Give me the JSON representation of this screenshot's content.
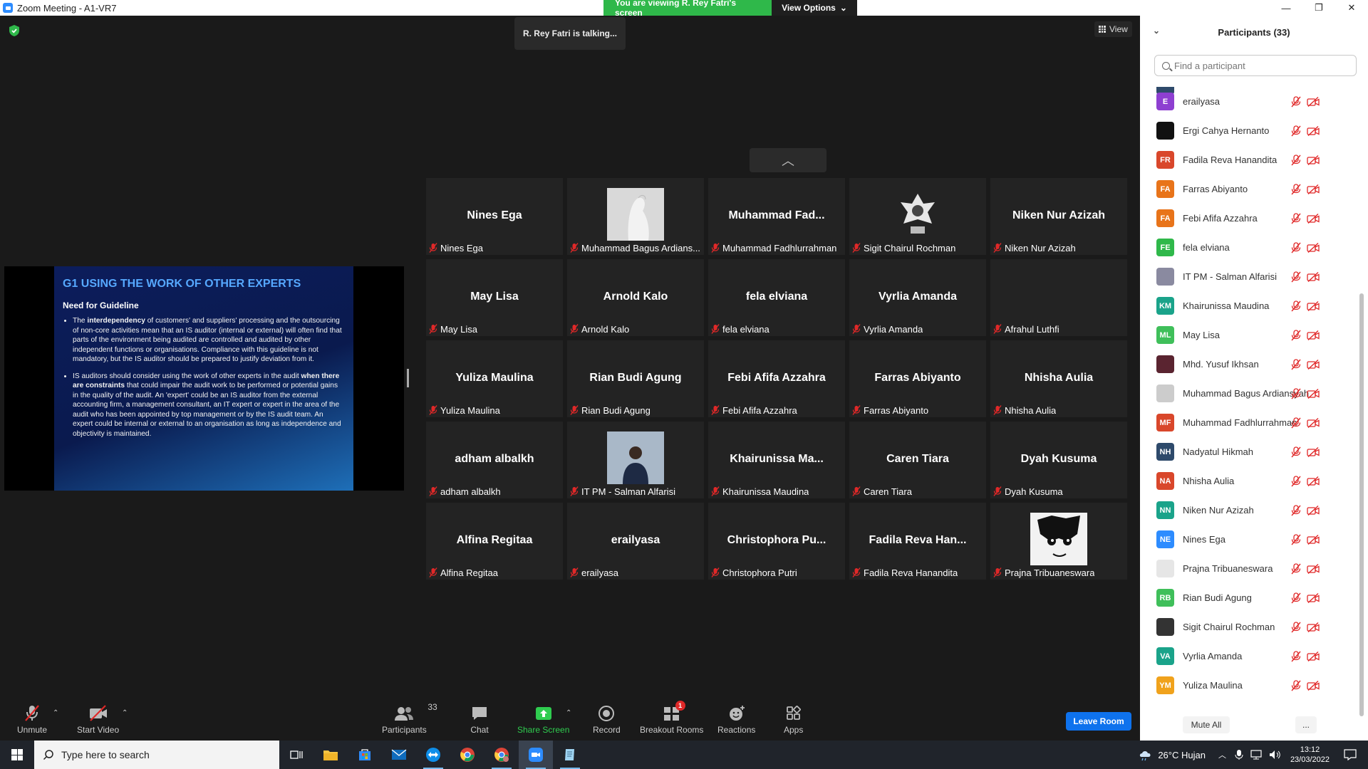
{
  "window": {
    "title": "Zoom Meeting - A1-VR7"
  },
  "banner": {
    "viewing": "You are viewing R. Rey Fatri's screen",
    "view_options": "View Options"
  },
  "talking": "R. Rey Fatri is talking...",
  "view_button": "View",
  "slide": {
    "title": "G1 USING THE WORK OF OTHER EXPERTS",
    "subtitle": "Need for Guideline",
    "bullet1_a": "The ",
    "bullet1_b": "interdependency",
    "bullet1_c": " of customers' and suppliers' processing and the outsourcing of non-core activities mean that an IS auditor (internal or external) will often find that parts of the environment being audited are controlled and audited by other independent functions or organisations. Compliance with this guideline is not mandatory, but the IS auditor should be prepared to justify deviation from it.",
    "bullet2_a": "IS auditors should consider using the work of other experts in the audit ",
    "bullet2_b": "when there are constraints",
    "bullet2_c": " that could impair the audit work to be performed or potential gains in the quality of the audit. An 'expert' could be an IS auditor from the external accounting firm, a management consultant, an IT expert or expert in the area of the audit who has been appointed by top management or by the IS audit team. An expert could be internal or external to an organisation as long as independence and objectivity is maintained."
  },
  "tiles": [
    {
      "big": "Nines Ega",
      "label": "Nines Ega",
      "photo": null
    },
    {
      "big": "",
      "label": "Muhammad Bagus Ardians...",
      "photo": "white-figure"
    },
    {
      "big": "Muhammad  Fad...",
      "label": "Muhammad Fadhlurrahman",
      "photo": null
    },
    {
      "big": "",
      "label": "Sigit Chairul Rochman",
      "photo": "emblem"
    },
    {
      "big": "Niken Nur Azizah",
      "label": "Niken Nur Azizah",
      "photo": null
    },
    {
      "big": "May Lisa",
      "label": "May Lisa",
      "photo": null
    },
    {
      "big": "Arnold Kalo",
      "label": "Arnold Kalo",
      "photo": null
    },
    {
      "big": "fela elviana",
      "label": "fela elviana",
      "photo": null
    },
    {
      "big": "Vyrlia Amanda",
      "label": "Vyrlia Amanda",
      "photo": null
    },
    {
      "big": "",
      "label": "Afrahul Luthfi",
      "photo": null
    },
    {
      "big": "Yuliza Maulina",
      "label": "Yuliza Maulina",
      "photo": null
    },
    {
      "big": "Rian Budi Agung",
      "label": "Rian Budi Agung",
      "photo": null
    },
    {
      "big": "Febi Afifa Azzahra",
      "label": "Febi Afifa Azzahra",
      "photo": null
    },
    {
      "big": "Farras Abiyanto",
      "label": "Farras Abiyanto",
      "photo": null
    },
    {
      "big": "Nhisha Aulia",
      "label": "Nhisha Aulia",
      "photo": null
    },
    {
      "big": "adham albalkh",
      "label": "adham albalkh",
      "photo": null
    },
    {
      "big": "",
      "label": "IT PM - Salman Alfarisi",
      "photo": "person"
    },
    {
      "big": "Khairunissa  Ma...",
      "label": "Khairunissa Maudina",
      "photo": null
    },
    {
      "big": "Caren Tiara",
      "label": "Caren Tiara",
      "photo": null
    },
    {
      "big": "Dyah Kusuma",
      "label": "Dyah Kusuma",
      "photo": null
    },
    {
      "big": "Alfina Regitaa",
      "label": "Alfina Regitaa",
      "photo": null
    },
    {
      "big": "erailyasa",
      "label": "erailyasa",
      "photo": null
    },
    {
      "big": "Christophora  Pu...",
      "label": "Christophora Putri",
      "photo": null
    },
    {
      "big": "Fadila  Reva  Han...",
      "label": "Fadila Reva Hanandita",
      "photo": null
    },
    {
      "big": "",
      "label": "Prajna Tribuaneswara",
      "photo": "manga"
    }
  ],
  "toolbar": {
    "unmute": "Unmute",
    "start_video": "Start Video",
    "participants": "Participants",
    "participants_count": "33",
    "chat": "Chat",
    "share_screen": "Share Screen",
    "record": "Record",
    "breakout_rooms": "Breakout Rooms",
    "breakout_badge": "1",
    "reactions": "Reactions",
    "apps": "Apps",
    "leave_room": "Leave Room"
  },
  "panel": {
    "title": "Participants (33)",
    "search_placeholder": "Find a participant",
    "mute_all": "Mute All",
    "more": "...",
    "participants": [
      {
        "initials": "E",
        "color": "#8e3fd1",
        "name": "erailyasa"
      },
      {
        "initials": "",
        "color": "#111111",
        "name": "Ergi Cahya Hernanto"
      },
      {
        "initials": "FR",
        "color": "#d9472b",
        "name": "Fadila Reva Hanandita"
      },
      {
        "initials": "FA",
        "color": "#e8741a",
        "name": "Farras Abiyanto"
      },
      {
        "initials": "FA",
        "color": "#e8741a",
        "name": "Febi Afifa Azzahra"
      },
      {
        "initials": "FE",
        "color": "#2fb84a",
        "name": "fela elviana"
      },
      {
        "initials": "",
        "color": "#8a8aa0",
        "name": "IT PM - Salman Alfarisi"
      },
      {
        "initials": "KM",
        "color": "#1aa38a",
        "name": "Khairunissa Maudina"
      },
      {
        "initials": "ML",
        "color": "#3fbf5a",
        "name": "May Lisa"
      },
      {
        "initials": "",
        "color": "#5a2430",
        "name": "Mhd. Yusuf Ikhsan"
      },
      {
        "initials": "",
        "color": "#cccccc",
        "name": "Muhammad Bagus Ardiansyah"
      },
      {
        "initials": "MF",
        "color": "#d9472b",
        "name": "Muhammad Fadhlurrahman"
      },
      {
        "initials": "NH",
        "color": "#2e4a6b",
        "name": "Nadyatul Hikmah"
      },
      {
        "initials": "NA",
        "color": "#d9472b",
        "name": "Nhisha Aulia"
      },
      {
        "initials": "NN",
        "color": "#1aa38a",
        "name": "Niken Nur Azizah"
      },
      {
        "initials": "NE",
        "color": "#2d8cff",
        "name": "Nines Ega"
      },
      {
        "initials": "",
        "color": "#e6e6e6",
        "name": "Prajna Tribuaneswara"
      },
      {
        "initials": "RB",
        "color": "#3fbf5a",
        "name": "Rian Budi Agung"
      },
      {
        "initials": "",
        "color": "#333333",
        "name": "Sigit Chairul Rochman"
      },
      {
        "initials": "VA",
        "color": "#1aa38a",
        "name": "Vyrlia Amanda"
      },
      {
        "initials": "YM",
        "color": "#f0a21c",
        "name": "Yuliza Maulina"
      }
    ]
  },
  "taskbar": {
    "search_placeholder": "Type here to search",
    "weather": "26°C  Hujan",
    "time": "13:12",
    "date": "23/03/2022"
  }
}
